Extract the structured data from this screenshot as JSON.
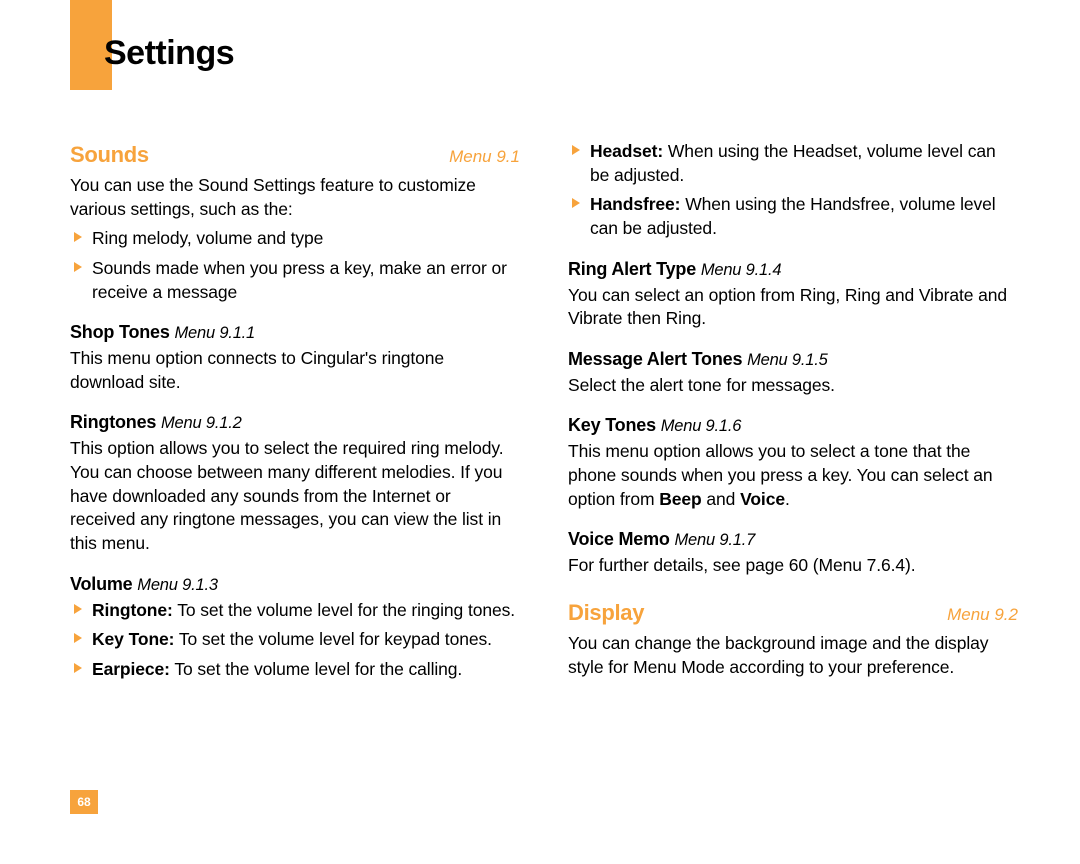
{
  "title": "Settings",
  "page_number": "68",
  "left": {
    "sounds": {
      "title": "Sounds",
      "menu": "Menu 9.1",
      "intro": "You can use the Sound Settings feature to customize various settings, such as the:",
      "bullets": [
        "Ring melody, volume and type",
        "Sounds made when you press a key, make an error or receive a message"
      ]
    },
    "shop_tones": {
      "title": "Shop Tones ",
      "menu": "Menu 9.1.1",
      "body": "This menu option connects to Cingular's ringtone download site."
    },
    "ringtones": {
      "title": "Ringtones ",
      "menu": "Menu 9.1.2",
      "body": "This option allows you to select the required ring melody. You can choose between many different melodies. If you have downloaded any sounds from the Internet or received any ringtone messages, you can view the list in this menu."
    },
    "volume": {
      "title": "Volume ",
      "menu": "Menu 9.1.3",
      "items": [
        {
          "label": "Ringtone:",
          "text": "To set the volume level for the ringing tones."
        },
        {
          "label": "Key Tone:",
          "text": "To set the volume level for keypad tones."
        },
        {
          "label": "Earpiece:",
          "text": "To set the volume level for the calling."
        }
      ]
    }
  },
  "right": {
    "volume_cont": [
      {
        "label": "Headset:",
        "text": "When using the Headset, volume level can be adjusted."
      },
      {
        "label": "Handsfree:",
        "text": "When using the Handsfree, volume level can be adjusted."
      }
    ],
    "ring_alert": {
      "title": "Ring Alert Type ",
      "menu": "Menu 9.1.4",
      "body": "You can select an option from Ring, Ring and Vibrate and Vibrate then Ring."
    },
    "msg_alert": {
      "title": "Message Alert Tones ",
      "menu": "Menu 9.1.5",
      "body": "Select the alert tone for messages."
    },
    "key_tones": {
      "title": "Key Tones ",
      "menu": "Menu 9.1.6",
      "body_pre": "This menu option allows you to select a tone that the phone sounds when you press a key. You can select an option from ",
      "bold1": "Beep",
      "and": " and ",
      "bold2": "Voice",
      "period": "."
    },
    "voice_memo": {
      "title": "Voice Memo ",
      "menu": "Menu 9.1.7",
      "body": "For further details, see page 60 (Menu 7.6.4)."
    },
    "display": {
      "title": "Display",
      "menu": "Menu 9.2",
      "body": "You can change the background image and the display style for Menu Mode according to your preference."
    }
  }
}
